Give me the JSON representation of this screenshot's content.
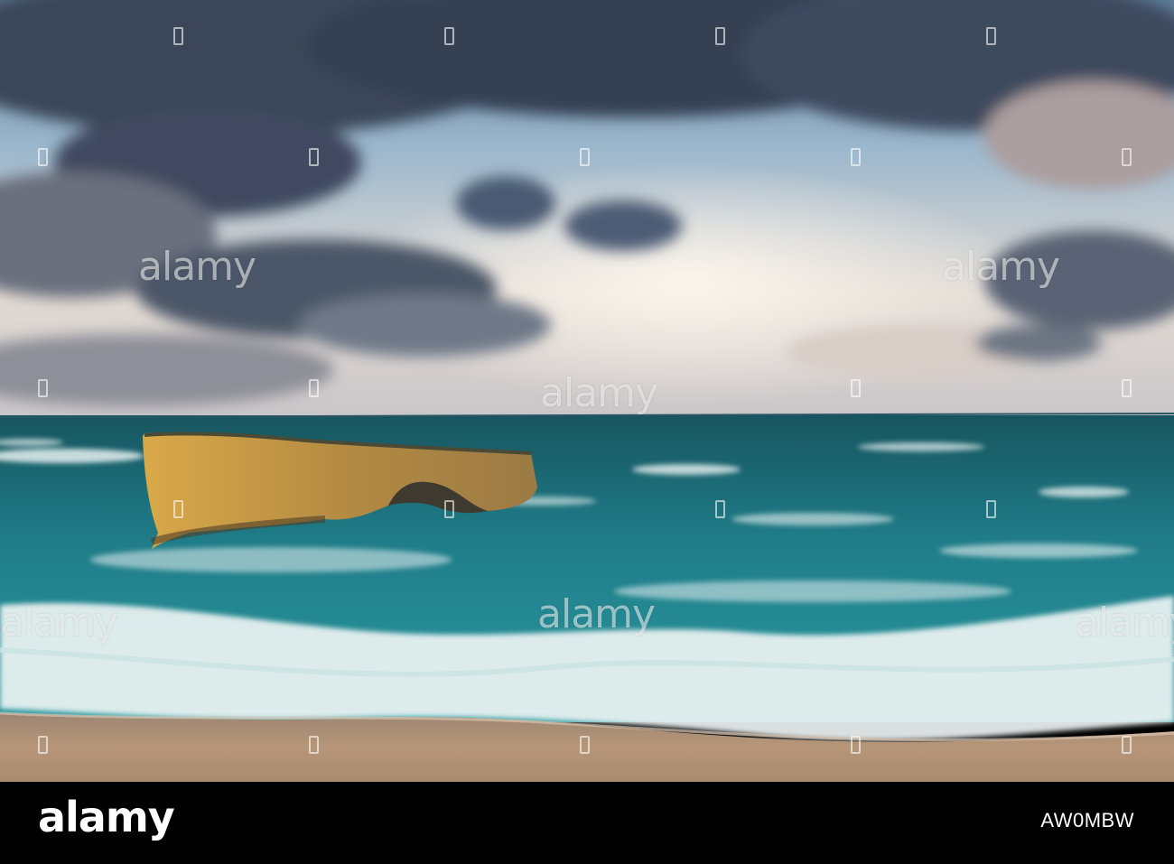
{
  "watermark": {
    "text": "alamy"
  },
  "footer": {
    "logo": "alamy",
    "image_id": "AW0MBW"
  },
  "colors": {
    "sky_blue": "#a9c3d6",
    "cloud_dark": "#3b4658",
    "sea": "#1f7a86",
    "foam": "#eef3f2",
    "sand": "#b99779",
    "rock": "#c79a48",
    "footer_bg": "#000000"
  }
}
